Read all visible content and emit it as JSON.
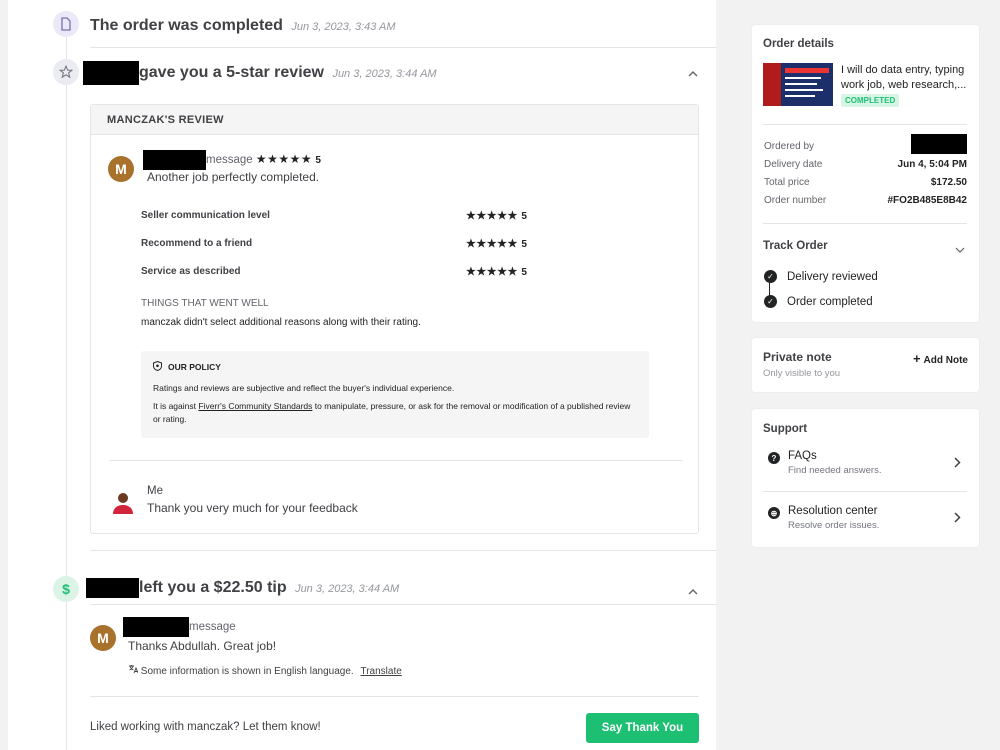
{
  "timeline": {
    "completed": {
      "text": "The order was completed",
      "date": "Jun 3, 2023, 3:43 AM"
    },
    "review_event": {
      "text": "gave you a 5-star review",
      "date": "Jun 3, 2023, 3:44 AM"
    },
    "tip_event": {
      "text": "left you a $22.50 tip",
      "date": "Jun 3, 2023, 3:44 AM"
    }
  },
  "review": {
    "title": "MANCZAK'S REVIEW",
    "avatar_letter": "M",
    "message_label": "message",
    "overall_rating": "5",
    "stars": "★★★★★",
    "body": "Another job perfectly completed.",
    "ratings": [
      {
        "label": "Seller communication level",
        "value": "5"
      },
      {
        "label": "Recommend to a friend",
        "value": "5"
      },
      {
        "label": "Service as described",
        "value": "5"
      }
    ],
    "went_well_title": "THINGS THAT WENT WELL",
    "went_well_text": "manczak didn't select additional reasons along with their rating.",
    "policy": {
      "title": "OUR POLICY",
      "line1": "Ratings and reviews are subjective and reflect the buyer's individual experience.",
      "line2_pre": "It is against ",
      "line2_link": "Fiverr's Community Standards",
      "line2_post": " to manipulate, pressure, or ask for the removal or modification of a published review or rating."
    },
    "reply": {
      "author": "Me",
      "text": "Thank you very much for your feedback"
    }
  },
  "tip": {
    "avatar_letter": "M",
    "message_label": "message",
    "body": "Thanks Abdullah. Great job!",
    "lang_note": "Some information is shown in English language.",
    "translate": "Translate"
  },
  "footer": {
    "prompt": "Liked working with manczak? Let them know!",
    "button": "Say Thank You"
  },
  "order": {
    "title": "Order details",
    "gig_title": "I will do data entry, typing work job, web research,...",
    "status": "COMPLETED",
    "ordered_by_label": "Ordered by",
    "delivery_label": "Delivery date",
    "delivery_value": "Jun 4, 5:04 PM",
    "price_label": "Total price",
    "price_value": "$172.50",
    "number_label": "Order number",
    "number_value": "#FO2B485E8B42",
    "track_title": "Track Order",
    "track_items": [
      "Delivery reviewed",
      "Order completed"
    ]
  },
  "private_note": {
    "title": "Private note",
    "subtitle": "Only visible to you",
    "add": "Add Note"
  },
  "support": {
    "title": "Support",
    "items": [
      {
        "title": "FAQs",
        "subtitle": "Find needed answers."
      },
      {
        "title": "Resolution center",
        "subtitle": "Resolve order issues."
      }
    ]
  }
}
